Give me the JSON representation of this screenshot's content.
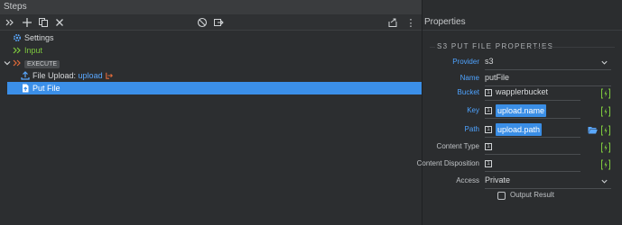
{
  "steps_panel": {
    "title": "Steps",
    "toolbar": {
      "expand_icon": "double-chevron-right-icon",
      "add_icon": "plus-icon",
      "copy_icon": "copy-icon",
      "delete_icon": "close-icon",
      "disable_icon": "circle-slash-icon",
      "move_icon": "move-out-icon",
      "export_icon": "export-icon",
      "more": "⋮"
    },
    "tree": [
      {
        "label": "Settings",
        "icon": "gear-icon"
      },
      {
        "label": "Input",
        "icon": "chevrons-icon"
      },
      {
        "label": "EXECUTE",
        "icon": "chevron-down-icon"
      },
      {
        "label_prefix": "File Upload:",
        "label_link": "upload",
        "icon": "upload-icon"
      },
      {
        "label": "Put File",
        "icon": "file-icon",
        "selected": true
      }
    ]
  },
  "properties_panel": {
    "title": "Properties",
    "section_title": "S3 PUT FILE PROPERTIES",
    "rows": {
      "provider": {
        "label": "Provider",
        "value": "s3"
      },
      "name": {
        "label": "Name",
        "value": "putFile"
      },
      "bucket": {
        "label": "Bucket",
        "value": "wapplerbucket"
      },
      "key": {
        "label": "Key",
        "value": "upload.name"
      },
      "path": {
        "label": "Path",
        "value": "upload.path"
      },
      "content_type": {
        "label": "Content Type",
        "value": ""
      },
      "content_disposition": {
        "label": "Content Disposition",
        "value": ""
      },
      "access": {
        "label": "Access",
        "value": "Private"
      },
      "output_result": {
        "label": "Output Result",
        "checked": false
      }
    }
  },
  "colors": {
    "accent": "#3b8fe8",
    "label_blue": "#4ea3ff",
    "bolt_green": "#7ec93e",
    "execute_orange": "#e06a3a"
  }
}
